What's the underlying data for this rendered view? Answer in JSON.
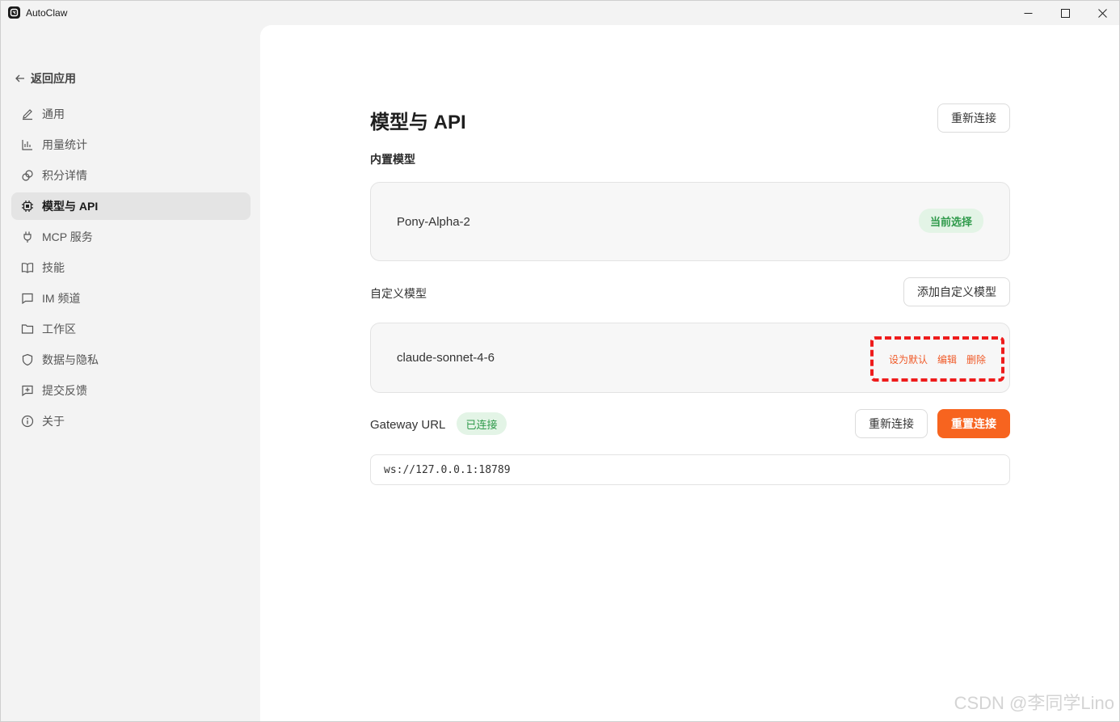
{
  "window": {
    "title": "AutoClaw",
    "controls": [
      "minimize",
      "maximize",
      "close"
    ]
  },
  "sidebar": {
    "back_label": "返回应用",
    "items": [
      {
        "label": "通用",
        "icon": "pencil-icon",
        "active": false
      },
      {
        "label": "用量统计",
        "icon": "bar-chart-icon",
        "active": false
      },
      {
        "label": "积分详情",
        "icon": "coins-icon",
        "active": false
      },
      {
        "label": "模型与 API",
        "icon": "chip-icon",
        "active": true
      },
      {
        "label": "MCP 服务",
        "icon": "plug-icon",
        "active": false
      },
      {
        "label": "技能",
        "icon": "book-icon",
        "active": false
      },
      {
        "label": "IM 频道",
        "icon": "chat-icon",
        "active": false
      },
      {
        "label": "工作区",
        "icon": "folder-icon",
        "active": false
      },
      {
        "label": "数据与隐私",
        "icon": "shield-icon",
        "active": false
      },
      {
        "label": "提交反馈",
        "icon": "feedback-icon",
        "active": false
      },
      {
        "label": "关于",
        "icon": "info-icon",
        "active": false
      }
    ]
  },
  "main": {
    "title": "模型与 API",
    "reconnect_label": "重新连接",
    "builtin": {
      "label": "内置模型",
      "model_name": "Pony-Alpha-2",
      "badge": "当前选择"
    },
    "custom": {
      "label": "自定义模型",
      "add_label": "添加自定义模型",
      "model_name": "claude-sonnet-4-6",
      "actions": {
        "set_default": "设为默认",
        "edit": "编辑",
        "delete": "删除"
      }
    },
    "gateway": {
      "label": "Gateway URL",
      "status": "已连接",
      "reconnect_label": "重新连接",
      "reset_label": "重置连接",
      "url": "ws://127.0.0.1:18789"
    }
  },
  "watermark": "CSDN @李同学Lino",
  "colors": {
    "accent": "#f7641f",
    "success": "#2f9a4b",
    "success_bg": "#e3f4e6",
    "highlight": "#ee1c1c"
  }
}
